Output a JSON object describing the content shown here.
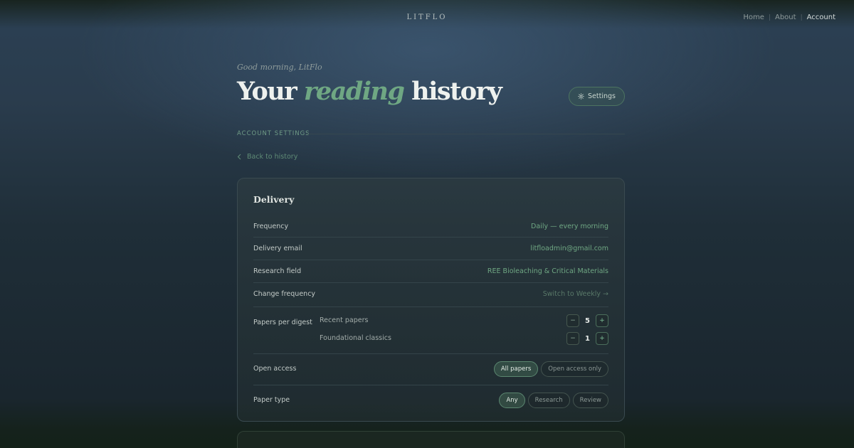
{
  "nav": {
    "brand": "LITFLO",
    "links": [
      {
        "label": "Home"
      },
      {
        "label": "About"
      },
      {
        "label": "Account"
      }
    ],
    "separator": "|"
  },
  "header": {
    "greeting": "Good morning, LitFlo",
    "title_before": "Your ",
    "title_accent": "reading",
    "title_after": " history",
    "settings_label": "Settings",
    "settings_icon": "gear-icon"
  },
  "section": {
    "label": "ACCOUNT SETTINGS",
    "back_label": "Back to history",
    "back_icon": "chevron-left-icon"
  },
  "delivery": {
    "title": "Delivery",
    "rows": [
      {
        "label": "Frequency",
        "value": "Daily — every morning"
      },
      {
        "label": "Delivery email",
        "value": "litfloadmin@gmail.com"
      },
      {
        "label": "Research field",
        "value": "REE Bioleaching & Critical Materials"
      },
      {
        "label": "Change frequency",
        "value": "Switch to Weekly →"
      }
    ],
    "papers": {
      "label": "Papers per digest",
      "items": [
        {
          "label": "Recent papers",
          "value": "5"
        },
        {
          "label": "Foundational classics",
          "value": "1"
        }
      ],
      "minus": "−",
      "plus": "+"
    },
    "open_access": {
      "label": "Open access",
      "options": [
        "All papers",
        "Open access only"
      ],
      "selected": "All papers"
    },
    "paper_type": {
      "label": "Paper type",
      "options": [
        "Any",
        "Research",
        "Review"
      ],
      "selected": "Any"
    }
  },
  "colors": {
    "accent": "#6fa783",
    "background": "#1f2e38"
  }
}
